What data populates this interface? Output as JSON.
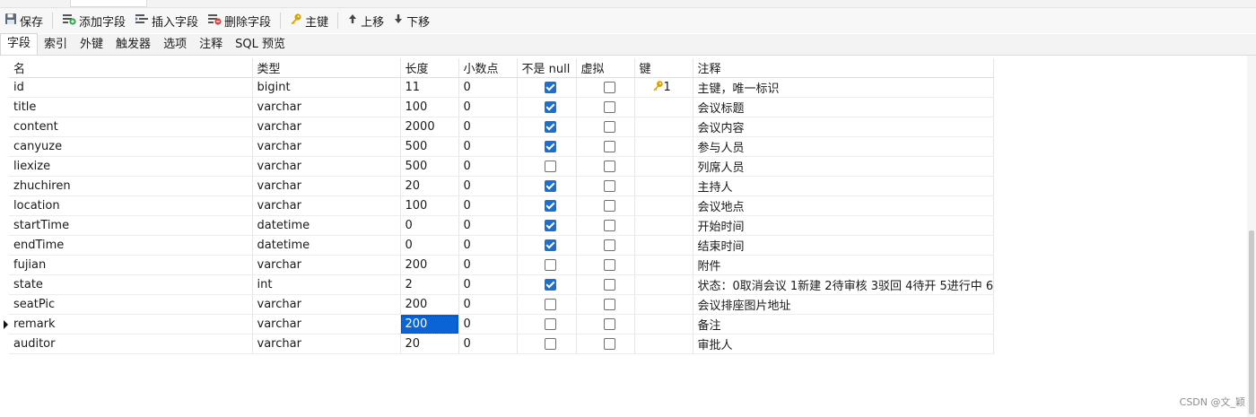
{
  "toolbar": {
    "save": "保存",
    "add_field": "添加字段",
    "insert_field": "插入字段",
    "delete_field": "删除字段",
    "primary_key": "主键",
    "move_up": "上移",
    "move_down": "下移"
  },
  "tabs": [
    "字段",
    "索引",
    "外键",
    "触发器",
    "选项",
    "注释",
    "SQL 预览"
  ],
  "columns": [
    "名",
    "类型",
    "长度",
    "小数点",
    "不是 null",
    "虚拟",
    "键",
    "注释"
  ],
  "rows": [
    {
      "name": "id",
      "type": "bigint",
      "length": "11",
      "decimals": "0",
      "not_null": true,
      "virtual": false,
      "key": "1",
      "comment": "主键，唯一标识"
    },
    {
      "name": "title",
      "type": "varchar",
      "length": "100",
      "decimals": "0",
      "not_null": true,
      "virtual": false,
      "key": "",
      "comment": "会议标题"
    },
    {
      "name": "content",
      "type": "varchar",
      "length": "2000",
      "decimals": "0",
      "not_null": true,
      "virtual": false,
      "key": "",
      "comment": "会议内容"
    },
    {
      "name": "canyuze",
      "type": "varchar",
      "length": "500",
      "decimals": "0",
      "not_null": true,
      "virtual": false,
      "key": "",
      "comment": "参与人员"
    },
    {
      "name": "liexize",
      "type": "varchar",
      "length": "500",
      "decimals": "0",
      "not_null": false,
      "virtual": false,
      "key": "",
      "comment": "列席人员"
    },
    {
      "name": "zhuchiren",
      "type": "varchar",
      "length": "20",
      "decimals": "0",
      "not_null": true,
      "virtual": false,
      "key": "",
      "comment": "主持人"
    },
    {
      "name": "location",
      "type": "varchar",
      "length": "100",
      "decimals": "0",
      "not_null": true,
      "virtual": false,
      "key": "",
      "comment": "会议地点"
    },
    {
      "name": "startTime",
      "type": "datetime",
      "length": "0",
      "decimals": "0",
      "not_null": true,
      "virtual": false,
      "key": "",
      "comment": "开始时间"
    },
    {
      "name": "endTime",
      "type": "datetime",
      "length": "0",
      "decimals": "0",
      "not_null": true,
      "virtual": false,
      "key": "",
      "comment": "结束时间"
    },
    {
      "name": "fujian",
      "type": "varchar",
      "length": "200",
      "decimals": "0",
      "not_null": false,
      "virtual": false,
      "key": "",
      "comment": "附件"
    },
    {
      "name": "state",
      "type": "int",
      "length": "2",
      "decimals": "0",
      "not_null": true,
      "virtual": false,
      "key": "",
      "comment": "状态：0取消会议 1新建 2待审核 3驳回 4待开 5进行中 6"
    },
    {
      "name": "seatPic",
      "type": "varchar",
      "length": "200",
      "decimals": "0",
      "not_null": false,
      "virtual": false,
      "key": "",
      "comment": "会议排座图片地址"
    },
    {
      "name": "remark",
      "type": "varchar",
      "length": "200",
      "decimals": "0",
      "not_null": false,
      "virtual": false,
      "key": "",
      "comment": "备注",
      "current": true
    },
    {
      "name": "auditor",
      "type": "varchar",
      "length": "20",
      "decimals": "0",
      "not_null": false,
      "virtual": false,
      "key": "",
      "comment": "审批人"
    }
  ],
  "watermark": "CSDN @文_颖",
  "colors": {
    "accent": "#1a6fd1",
    "selection": "#0a64d6",
    "key_icon": "#d9a400"
  }
}
